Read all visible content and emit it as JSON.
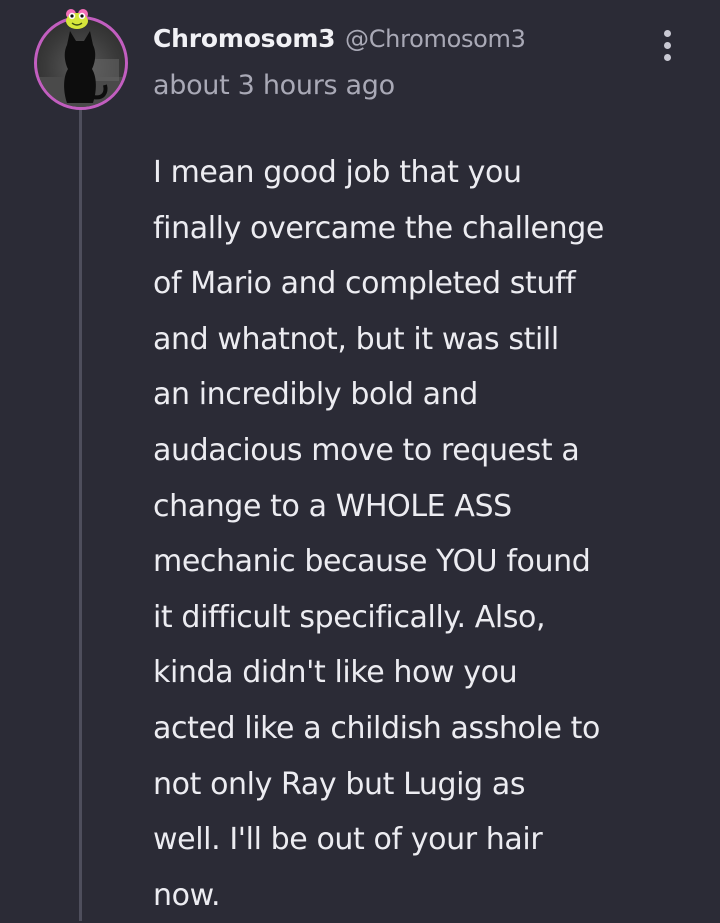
{
  "comment": {
    "author": {
      "display_name": "Chromosom3",
      "handle": "@Chromosom3",
      "avatar_icon": "black-cat-avatar",
      "avatar_ring_color": "#c25ec0",
      "badge_icon": "frog-badge-icon"
    },
    "timestamp": "about 3 hours ago",
    "more_icon": "more-vertical-icon",
    "body_lines": [
      "I mean good job that you",
      "finally overcame the challenge",
      "of Mario and completed stuff",
      "and whatnot, but it was still",
      "an incredibly bold and",
      "audacious move to request a",
      "change to a WHOLE ASS",
      "mechanic because YOU found",
      "it difficult specifically. Also,",
      "kinda didn't like how you",
      "acted like a childish asshole to",
      "not only Ray but Lugig as",
      "well. I'll be out of your hair",
      "now."
    ]
  },
  "colors": {
    "background": "#2b2b36",
    "text_primary": "#ececf1",
    "text_secondary": "#a9a9b6",
    "thread_line": "#4e4e5c"
  }
}
